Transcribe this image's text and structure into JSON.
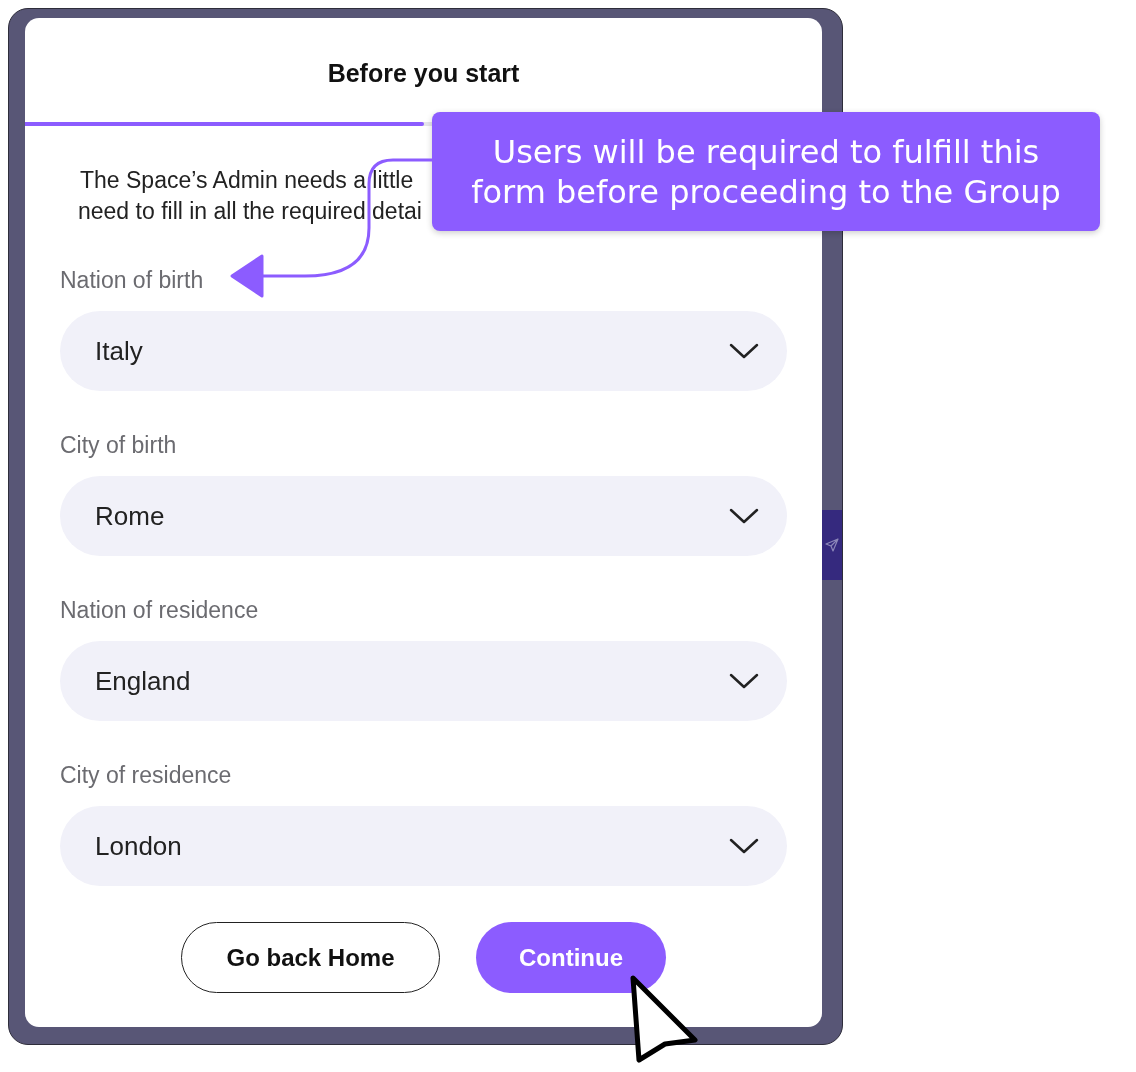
{
  "dialog": {
    "title": "Before you start",
    "progress": {
      "level": 0.5
    },
    "description_lines": [
      "The Space’s Admin needs a little",
      "need to fill in all the required detai"
    ],
    "fields": [
      {
        "label": "Nation of birth",
        "value": "Italy"
      },
      {
        "label": "City of birth",
        "value": "Rome"
      },
      {
        "label": "Nation of residence",
        "value": "England"
      },
      {
        "label": "City of residence",
        "value": "London"
      }
    ],
    "buttons": [
      {
        "kind": "secondary",
        "label": "Go back Home"
      },
      {
        "kind": "primary",
        "label": "Continue"
      }
    ]
  },
  "callout": {
    "lines": [
      "Users will be required to fulfill this",
      "form before proceeding to the Group"
    ]
  }
}
